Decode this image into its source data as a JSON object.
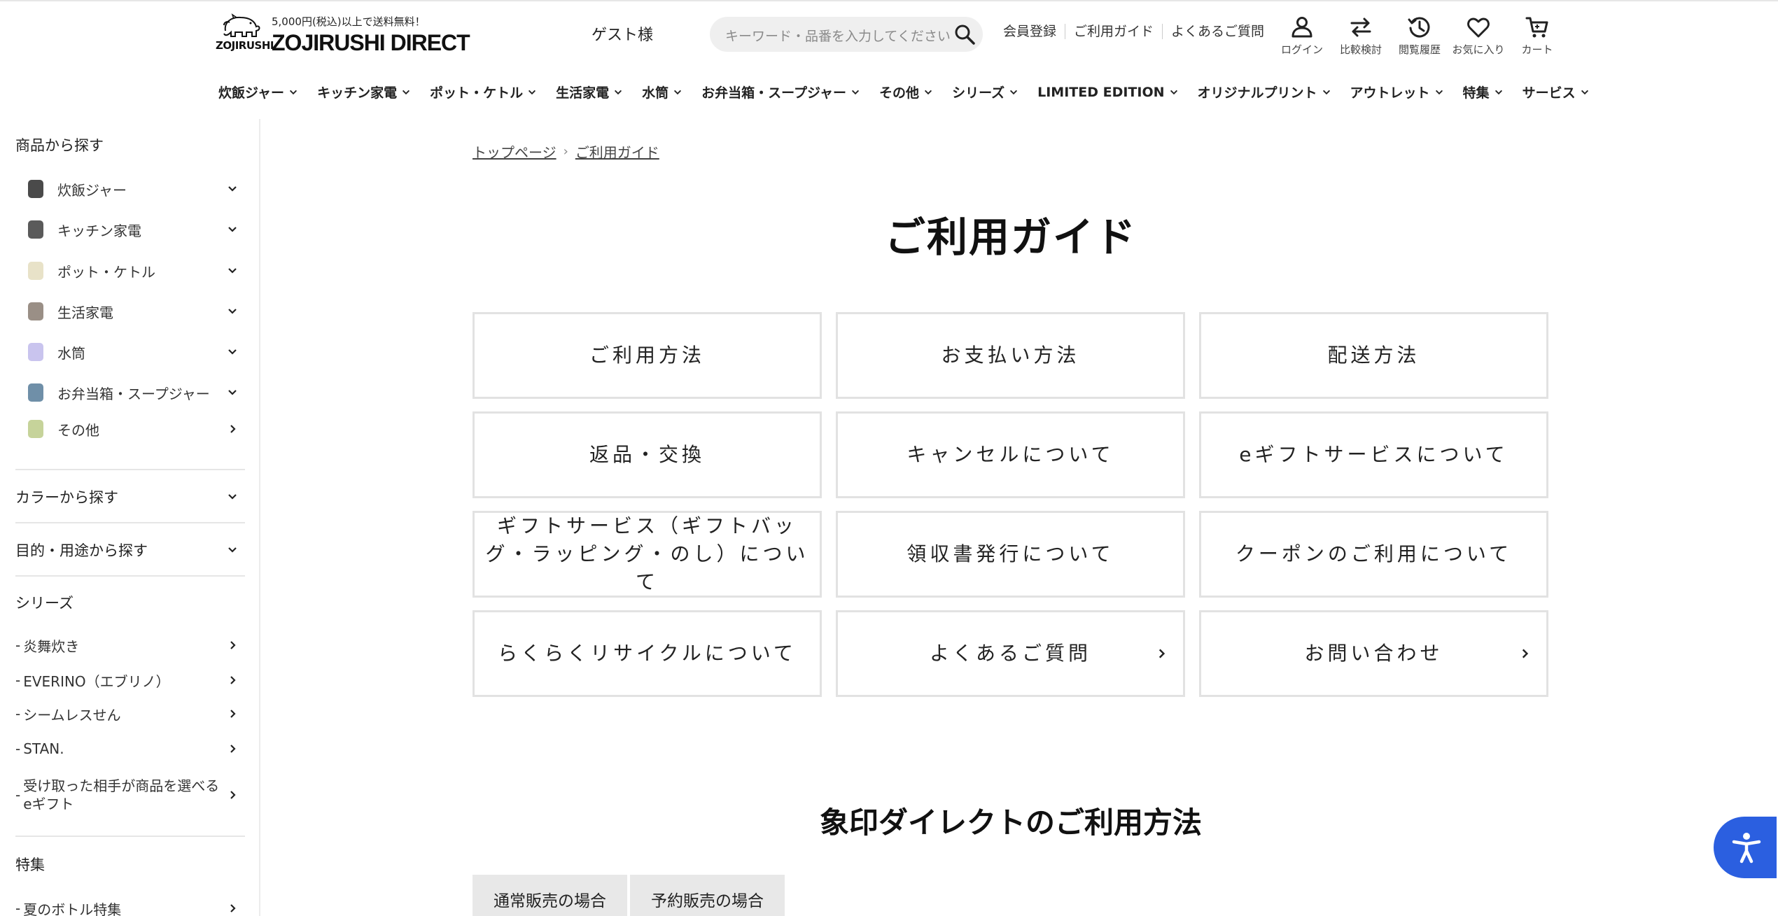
{
  "header": {
    "shipping_notice": "5,000円(税込)以上で送料無料！",
    "brand_mark": "ZOJIRUSHI",
    "brand_name": "ZOJIRUSHI DIRECT",
    "guest_label": "ゲスト様",
    "search": {
      "placeholder": "キーワード・品番を入力してください"
    },
    "top_links": [
      "会員登録",
      "ご利用ガイド",
      "よくあるご質問"
    ],
    "icon_nav": [
      {
        "label": "ログイン",
        "icon": "user-icon"
      },
      {
        "label": "比較検討",
        "icon": "compare-icon"
      },
      {
        "label": "閲覧履歴",
        "icon": "history-icon"
      },
      {
        "label": "お気に入り",
        "icon": "heart-icon"
      },
      {
        "label": "カート",
        "icon": "cart-icon"
      }
    ],
    "main_nav": [
      "炊飯ジャー",
      "キッチン家電",
      "ポット・ケトル",
      "生活家電",
      "水筒",
      "お弁当箱・スープジャー",
      "その他",
      "シリーズ",
      "LIMITED EDITION",
      "オリジナルプリント",
      "アウトレット",
      "特集",
      "サービス"
    ]
  },
  "sidebar": {
    "product_heading": "商品から探す",
    "categories": [
      {
        "label": "炊飯ジャー",
        "color": "#4a4a4a"
      },
      {
        "label": "キッチン家電",
        "color": "#5a5a5a"
      },
      {
        "label": "ポット・ケトル",
        "color": "#e8e2c8"
      },
      {
        "label": "生活家電",
        "color": "#9a8f86"
      },
      {
        "label": "水筒",
        "color": "#c9c4ee"
      },
      {
        "label": "お弁当箱・スープジャー",
        "color": "#6f8fa8"
      },
      {
        "label": "その他",
        "color": "#c6d39a"
      }
    ],
    "color_heading": "カラーから探す",
    "purpose_heading": "目的・用途から探す",
    "series_heading": "シリーズ",
    "series": [
      "炎舞炊き",
      "EVERINO（エブリノ）",
      "シームレスせん",
      "STAN.",
      "受け取った相手が商品を選べるeギフト"
    ],
    "feature_heading": "特集",
    "features": [
      "夏のボトル特集"
    ]
  },
  "breadcrumb": {
    "home": "トップページ",
    "current": "ご利用ガイド"
  },
  "page_title": "ご利用ガイド",
  "guide_buttons": [
    "ご利用方法",
    "お支払い方法",
    "配送方法",
    "返品・交換",
    "キャンセルについて",
    "eギフトサービスについて",
    "ギフトサービス（ギフトバッグ・ラッピング・のし）について",
    "領収書発行について",
    "クーポンのご利用について",
    "らくらくリサイクルについて",
    "よくあるご質問",
    "お問い合わせ"
  ],
  "section_title": "象印ダイレクトのご利用方法",
  "tabs": [
    "通常販売の場合",
    "予約販売の場合"
  ],
  "accessibility_button": {
    "icon": "accessibility-icon",
    "color": "#2b5fe0"
  }
}
